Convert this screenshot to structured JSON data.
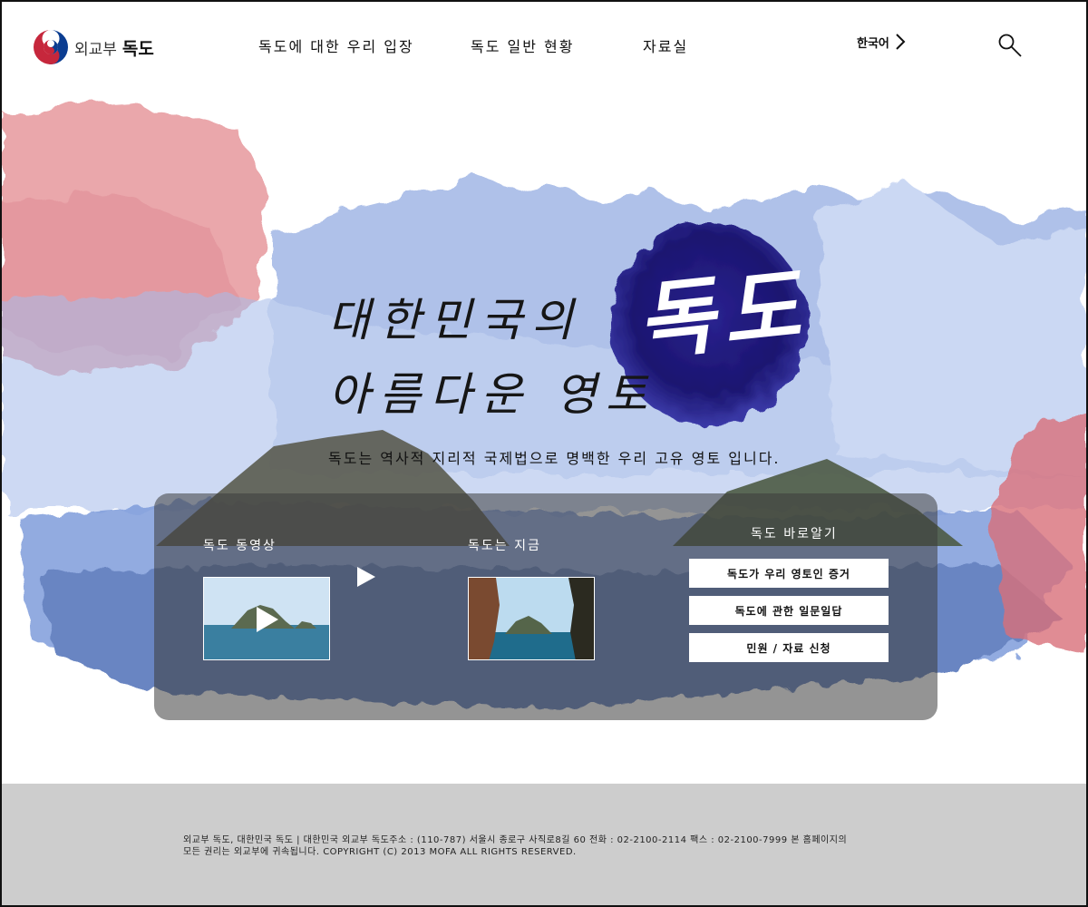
{
  "brand": {
    "prefix": "외교부",
    "name": "독도"
  },
  "nav": {
    "items": [
      "독도에 대한 우리 입장",
      "독도 일반 현황",
      "자료실"
    ],
    "language": "한국어"
  },
  "hero": {
    "headline_line1": "대한민국의",
    "headline_line2": "아름다운 영토",
    "ink_title": "독도",
    "subtitle": "독도는 역사적 지리적 국제법으로 명백한 우리 고유 영토 입니다."
  },
  "panel": {
    "video_title": "독도 동영상",
    "now_title": "독도는 지금",
    "learn_title": "독도 바로알기",
    "links": [
      "독도가 우리 영토인 증거",
      "독도에 관한 일문일답",
      "민원 / 자료 신청"
    ]
  },
  "footer": {
    "line1": "외교부 독도, 대한민국 독도 | 대한민국 외교부 독도주소 : (110-787) 서울시 종로구 사직로8길 60   전화 : 02-2100-2114   팩스 : 02-2100-7999  본 홈페이지의",
    "line2": "모든 권리는 외교부에 귀속됩니다.  COPYRIGHT (C) 2013 MOFA ALL RIGHTS RESERVED."
  },
  "colors": {
    "ink_blue": "#1b1570",
    "wash_blue": "#7f9ddb",
    "wash_red": "#d9707a",
    "footer_bg": "#cdcdcd"
  }
}
